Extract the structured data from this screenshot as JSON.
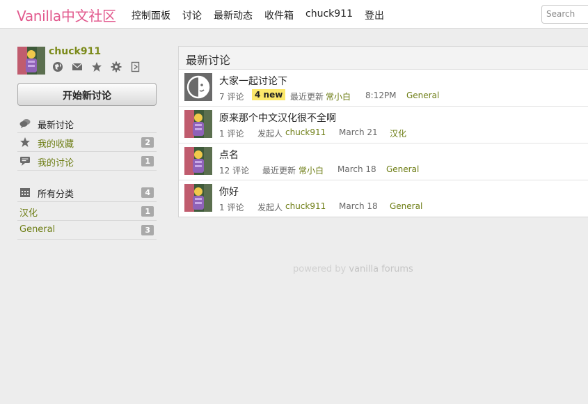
{
  "header": {
    "brand": "Vanilla中文社区",
    "nav": [
      "控制面板",
      "讨论",
      "最新动态",
      "收件箱",
      "chuck911",
      "登出"
    ],
    "search_placeholder": "Search"
  },
  "sidebar": {
    "username": "chuck911",
    "profile_icons": [
      "globe-icon",
      "mail-icon",
      "star-icon",
      "gear-icon",
      "signout-icon"
    ],
    "new_discussion_label": "开始新讨论",
    "menu": [
      {
        "label": "最新讨论",
        "icon": "chat-bubbles-icon",
        "count": ""
      },
      {
        "label": "我的收藏",
        "icon": "star-icon",
        "count": "2"
      },
      {
        "label": "我的讨论",
        "icon": "comment-icon",
        "count": "1"
      }
    ],
    "categories": [
      {
        "label": "所有分类",
        "icon": "calendar-grid-icon",
        "count": "4"
      },
      {
        "label": "汉化",
        "count": "1"
      },
      {
        "label": "General",
        "count": "3"
      }
    ]
  },
  "main": {
    "title": "最新讨论",
    "discussions": [
      {
        "title": "大家一起讨论下",
        "comments": "7 评论",
        "new": "4 new",
        "author_label": "最近更新",
        "author": "常小白",
        "date": "8:12PM",
        "category": "General"
      },
      {
        "title": "原来那个中文汉化很不全啊",
        "comments": "1 评论",
        "author_label": "发起人",
        "author": "chuck911",
        "date": "March 21",
        "category": "汉化"
      },
      {
        "title": "点名",
        "comments": "12 评论",
        "author_label": "最近更新",
        "author": "常小白",
        "date": "March 18",
        "category": "General"
      },
      {
        "title": "你好",
        "comments": "1 评论",
        "author_label": "发起人",
        "author": "chuck911",
        "date": "March 18",
        "category": "General"
      }
    ]
  },
  "footer": {
    "prefix": "powered by",
    "name": "vanilla forums"
  }
}
